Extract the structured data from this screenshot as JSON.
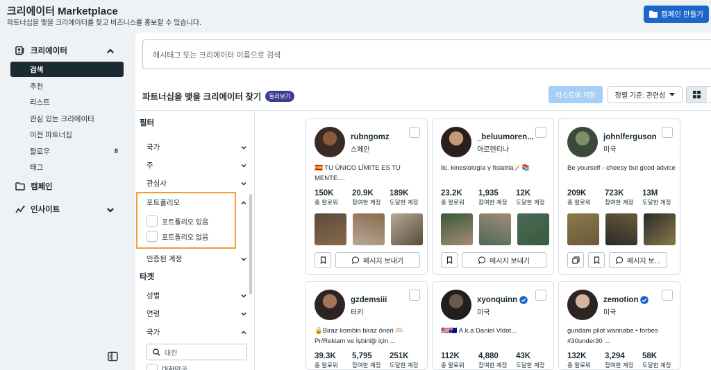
{
  "header": {
    "title": "크리에이터 Marketplace",
    "subtitle": "파트너십을 맺을 크리에이터를 찾고 비즈니스를 홍보할 수 있습니다.",
    "create_campaign": "캠페인 만들기"
  },
  "sidebar": {
    "creators_label": "크리에이터",
    "items": [
      {
        "label": "검색"
      },
      {
        "label": "추천"
      },
      {
        "label": "리스트"
      },
      {
        "label": "관심 있는 크리에이터"
      },
      {
        "label": "이전 파트너십"
      },
      {
        "label": "팔로우",
        "badge": "8"
      },
      {
        "label": "태그"
      }
    ],
    "campaign_label": "캠페인",
    "insights_label": "인사이트"
  },
  "search": {
    "placeholder": "해시태그 또는 크리에이터 이름으로 검색"
  },
  "toolbar": {
    "title": "파트너십을 맺을 크리에이터 찾기",
    "beta": "둘러보기",
    "save_list": "리스트에 저장",
    "sort": "정렬 기준: 관련성"
  },
  "filters": {
    "heading": "필터",
    "country": "국가",
    "state": "주",
    "interests": "관심사",
    "portfolio": "포트폴리오",
    "portfolio_yes": "포트폴리오 있음",
    "portfolio_no": "포트폴리오 없음",
    "verified": "인증된 계정",
    "target_heading": "타겟",
    "gender": "성별",
    "age": "연령",
    "target_country": "국가",
    "country_search": "대한",
    "partial_option": "대한민국"
  },
  "stat_labels": {
    "followers": "총 팔로워",
    "engaged": "참여한 계정",
    "reached": "도달한 계정"
  },
  "card_actions": {
    "message": "메시지 보내기",
    "message_short": "메시지 보..."
  },
  "creators": [
    {
      "username": "rubngomz",
      "country": "스페인",
      "verified": false,
      "bio": "🇪🇸 TU ÚNICO LÍMITE ES TU MENTE....",
      "followers": "150K",
      "engaged": "20.9K",
      "reached": "189K"
    },
    {
      "username": "_beluumoren...",
      "country": "아르헨티나",
      "verified": false,
      "bio": "lic. kinesiología y fisiatria🪄📚",
      "followers": "23.2K",
      "engaged": "1,935",
      "reached": "12K"
    },
    {
      "username": "johnlferguson",
      "country": "미국",
      "verified": false,
      "bio": "Be yourself - cheesy but good advice",
      "followers": "209K",
      "engaged": "723K",
      "reached": "13M"
    },
    {
      "username": "gzdemsiii",
      "country": "터키",
      "verified": false,
      "bio": "🔒Biraz kombin biraz öneri 🫶🏻 Pr/Reklam ve İşbirliği için ...",
      "followers": "39.3K",
      "engaged": "5,795",
      "reached": "251K"
    },
    {
      "username": "xyonquinn",
      "country": "미국",
      "verified": true,
      "bio": "🇺🇸🇦🇺 A.k.a Daniel Vidot...",
      "followers": "112K",
      "engaged": "4,880",
      "reached": "43K"
    },
    {
      "username": "zemotion",
      "country": "미국",
      "verified": true,
      "bio": "gundam pilot wannabe • forbes #30under30 ...",
      "followers": "132K",
      "engaged": "3,294",
      "reached": "58K"
    }
  ],
  "colors": {
    "primary": "#1b66c9",
    "highlight": "#f39c3d",
    "beta": "#3b3f8f",
    "verified": "#1b66c9"
  }
}
